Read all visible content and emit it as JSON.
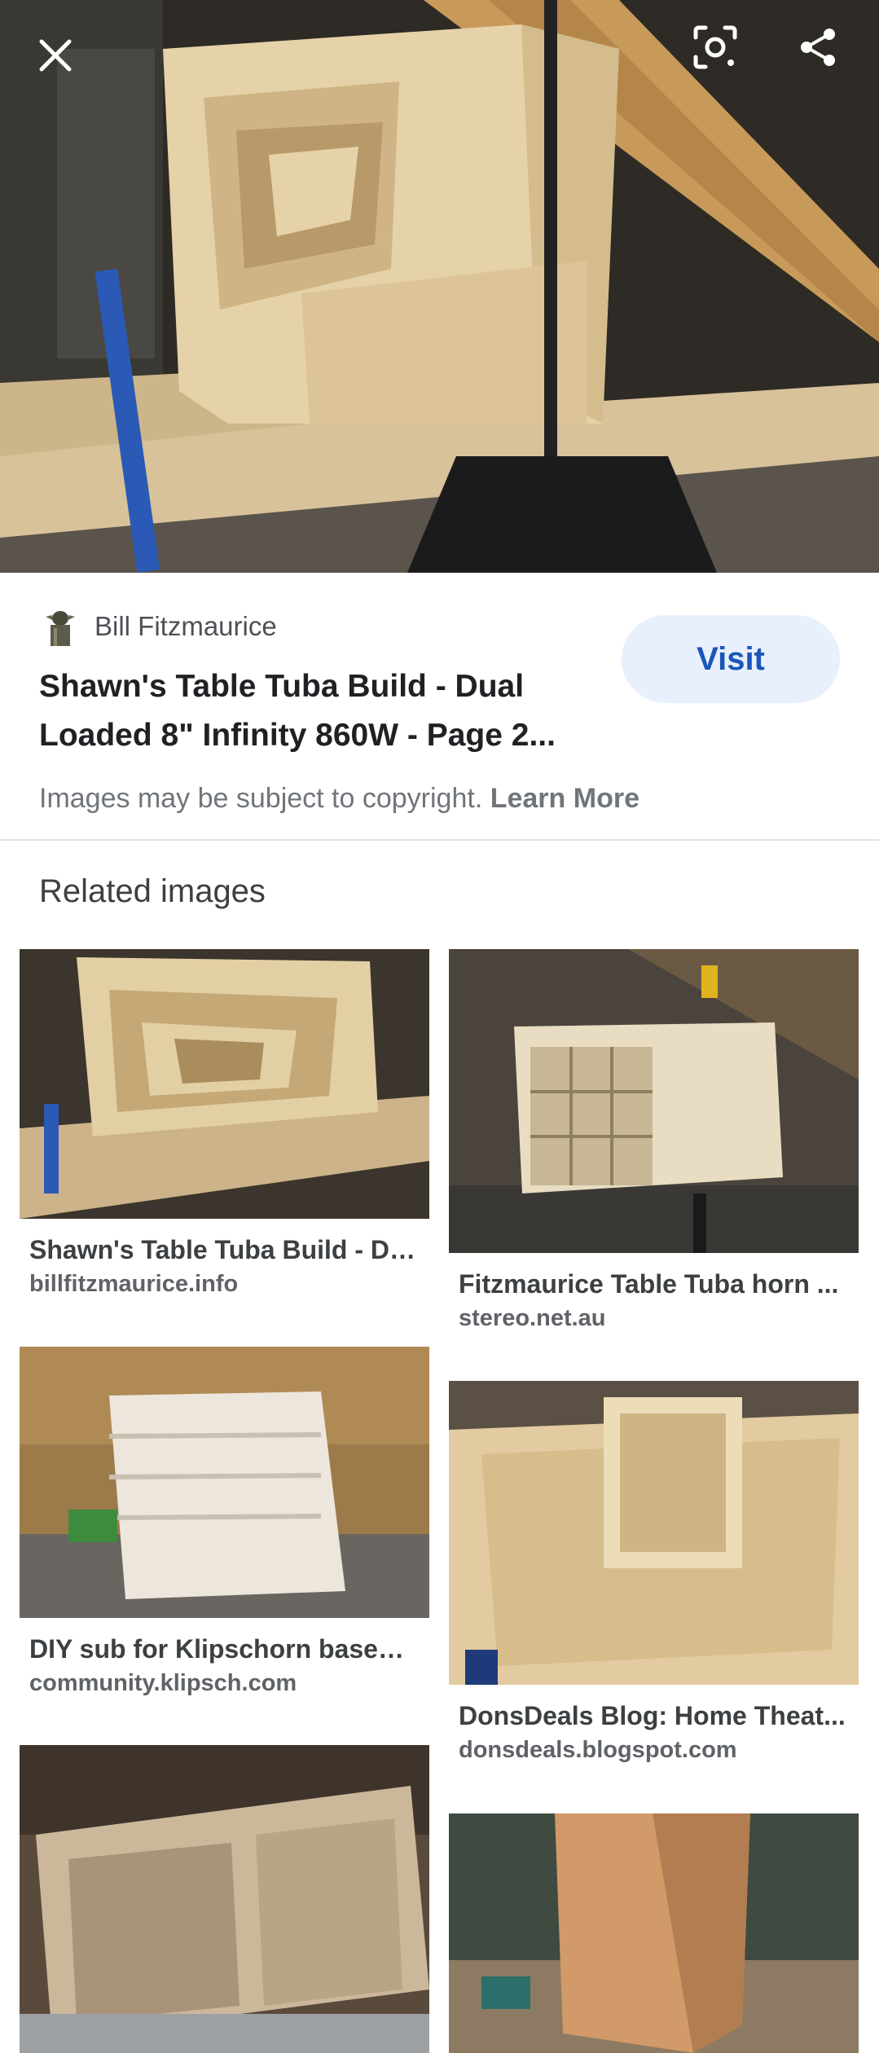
{
  "toolbar": {
    "close_icon": "close-icon",
    "lens_icon": "lens-icon",
    "share_icon": "share-icon"
  },
  "result": {
    "source_name": "Bill Fitzmaurice",
    "title_line1": "Shawn's Table Tuba Build - Dual",
    "title_line2": "Loaded 8\" Infinity 860W - Page 2...",
    "visit_label": "Visit",
    "copyright_text": "Images may be subject to copyright.",
    "learn_more": "Learn More"
  },
  "related": {
    "heading": "Related images",
    "items": [
      {
        "title": "Shawn's Table Tuba Build - Du...",
        "site": "billfitzmaurice.info"
      },
      {
        "title": "Fitzmaurice Table Tuba horn ...",
        "site": "stereo.net.au"
      },
      {
        "title": "DIY sub for Klipschorn based ...",
        "site": "community.klipsch.com"
      },
      {
        "title": "DonsDeals Blog: Home Theat...",
        "site": "donsdeals.blogspot.com"
      }
    ]
  },
  "colors": {
    "accent": "#1a56b8",
    "visit_bg": "#e8f0fe",
    "muted": "#70757a"
  }
}
